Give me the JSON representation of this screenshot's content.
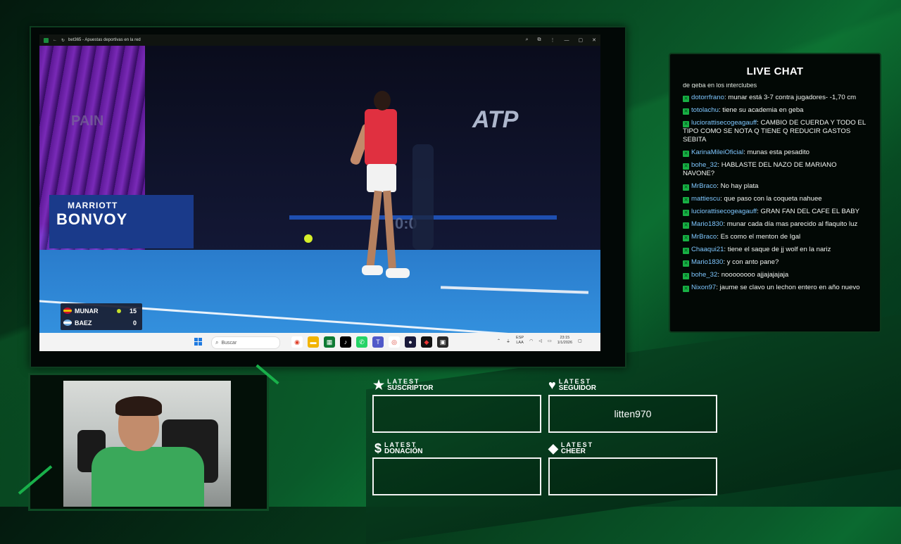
{
  "browser": {
    "tab_title": "bet365 - Apuestas deportivas en la red",
    "controls": [
      "—",
      "▢",
      "✕"
    ]
  },
  "video": {
    "sponsor_line1": "MARRIOTT",
    "sponsor_line2": "BONVOY",
    "atp_text": "ATP",
    "country_text": "PAIN",
    "clock_text": "0:0",
    "scoreboard": {
      "players": [
        {
          "name": "MUNAR",
          "score": "15",
          "serving": true
        },
        {
          "name": "BAEZ",
          "score": "0",
          "serving": false
        }
      ]
    }
  },
  "taskbar": {
    "search_placeholder": "Buscar",
    "lang_line1": "ESP",
    "lang_line2": "LAA",
    "time": "23:15",
    "date": "1/1/2026"
  },
  "chat": {
    "title": "LIVE CHAT",
    "partial_top": "de geba en los interclubes",
    "messages": [
      {
        "user": "dotorrfrano",
        "text": "munar está 3-7 contra jugadores- -1,70 cm"
      },
      {
        "user": "totolachu",
        "text": "tiene su academia en geba"
      },
      {
        "user": "luciorattisecogeagauff",
        "text": "CAMBIO DE CUERDA Y TODO EL TIPO COMO SE NOTA Q TIENE Q REDUCIR GASTOS SEBITA"
      },
      {
        "user": "KarinaMileiOficial",
        "text": "munas esta pesadito"
      },
      {
        "user": "bohe_32",
        "text": "HABLASTE DEL NAZO DE MARIANO NAVONE?"
      },
      {
        "user": "MrBraco",
        "text": "No hay plata"
      },
      {
        "user": "mattiescu",
        "text": "que paso con la coqueta nahuee"
      },
      {
        "user": "luciorattisecogeagauff",
        "text": "GRAN FAN DEL CAFE EL BABY"
      },
      {
        "user": "Mario1830",
        "text": "munar cada día mas parecido al flaquito luz"
      },
      {
        "user": "MrBraco",
        "text": "Es como el menton de Igal"
      },
      {
        "user": "Chaaqui21",
        "text": "tiene el saque de jj wolf en la nariz"
      },
      {
        "user": "Mario1830",
        "text": "y con anto pane?"
      },
      {
        "user": "bohe_32",
        "text": "noooooooo ajjajajajaja"
      },
      {
        "user": "Nixon97",
        "text": "jaume se clavo un lechon entero en año nuevo"
      }
    ]
  },
  "latest": {
    "suscriptor": {
      "small": "LATEST",
      "big": "SUSCRIPTOR",
      "value": ""
    },
    "seguidor": {
      "small": "LATEST",
      "big": "SEGUIDOR",
      "value": "litten970"
    },
    "donacion": {
      "small": "LATEST",
      "big": "DONACIÓN",
      "value": ""
    },
    "cheer": {
      "small": "LATEST",
      "big": "CHEER",
      "value": ""
    }
  },
  "colors": {
    "accent_green": "#19b04a",
    "chat_username": "#7fc7ff"
  }
}
